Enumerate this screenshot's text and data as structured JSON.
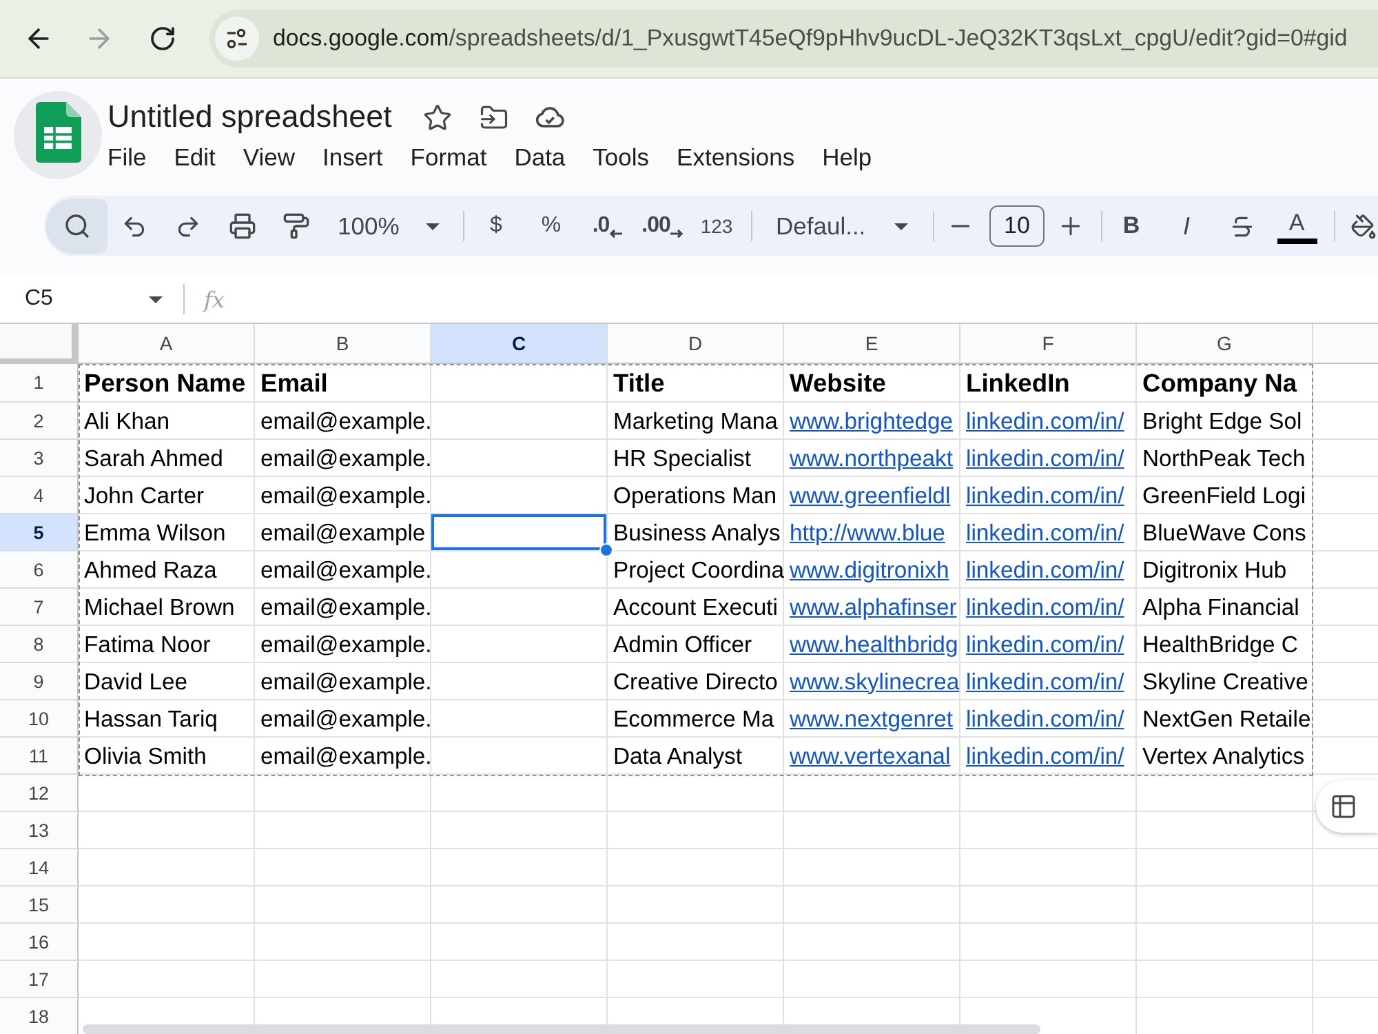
{
  "browser": {
    "back": {
      "disabled": false
    },
    "forward": {
      "disabled": true
    },
    "url_host": "docs.google.com",
    "url_path": "/spreadsheets/d/1_PxusgwtT45eQf9pHhv9ucDL-JeQ32KT3qsLxt_cpgU/edit?gid=0#gid"
  },
  "document": {
    "title": "Untitled spreadsheet"
  },
  "menu": [
    "File",
    "Edit",
    "View",
    "Insert",
    "Format",
    "Data",
    "Tools",
    "Extensions",
    "Help"
  ],
  "toolbar": {
    "zoom": "100%",
    "currency": "$",
    "percent": "%",
    "decrease_decimal": ".0",
    "increase_decimal": ".00",
    "number_format": "123",
    "font": "Defaul...",
    "font_size": "10",
    "bold": "B",
    "italic": "I",
    "text_color": "A"
  },
  "formula_bar": {
    "name_box": "C5",
    "function_label": "fx"
  },
  "sheet": {
    "copy_outline": true,
    "columns": [
      {
        "label": "A",
        "selected": false
      },
      {
        "label": "B",
        "selected": false
      },
      {
        "label": "C",
        "selected": true
      },
      {
        "label": "D",
        "selected": false
      },
      {
        "label": "E",
        "selected": false
      },
      {
        "label": "F",
        "selected": false
      },
      {
        "label": "G",
        "selected": false
      }
    ],
    "rows": [
      {
        "number": "1",
        "kind": "header",
        "selected": false,
        "cells": [
          {
            "kind": "text",
            "text": "Person Name"
          },
          {
            "kind": "text",
            "text": "Email"
          },
          {
            "kind": "empty"
          },
          {
            "kind": "text",
            "text": "Title"
          },
          {
            "kind": "text",
            "text": "Website"
          },
          {
            "kind": "text",
            "text": "LinkedIn"
          },
          {
            "kind": "text",
            "text": "Company Na"
          }
        ]
      },
      {
        "number": "2",
        "kind": "data",
        "selected": false,
        "cells": [
          {
            "kind": "text",
            "text": "Ali Khan"
          },
          {
            "kind": "text",
            "text": "email@example."
          },
          {
            "kind": "empty"
          },
          {
            "kind": "text",
            "text": "Marketing Mana"
          },
          {
            "kind": "link",
            "text": "www.brightedge"
          },
          {
            "kind": "link",
            "text": "linkedin.com/in/"
          },
          {
            "kind": "text",
            "text": "Bright Edge Sol"
          }
        ]
      },
      {
        "number": "3",
        "kind": "data",
        "selected": false,
        "cells": [
          {
            "kind": "text",
            "text": "Sarah Ahmed"
          },
          {
            "kind": "text",
            "text": "email@example."
          },
          {
            "kind": "empty"
          },
          {
            "kind": "text",
            "text": "HR Specialist"
          },
          {
            "kind": "link",
            "text": "www.northpeakt"
          },
          {
            "kind": "link",
            "text": "linkedin.com/in/"
          },
          {
            "kind": "text",
            "text": "NorthPeak Tech"
          }
        ]
      },
      {
        "number": "4",
        "kind": "data",
        "selected": false,
        "cells": [
          {
            "kind": "text",
            "text": "John Carter"
          },
          {
            "kind": "text",
            "text": "email@example."
          },
          {
            "kind": "empty"
          },
          {
            "kind": "text",
            "text": "Operations Man"
          },
          {
            "kind": "link",
            "text": "www.greenfieldl"
          },
          {
            "kind": "link",
            "text": "linkedin.com/in/"
          },
          {
            "kind": "text",
            "text": "GreenField Logi"
          }
        ]
      },
      {
        "number": "5",
        "kind": "data",
        "selected": true,
        "cells": [
          {
            "kind": "text",
            "text": "Emma Wilson"
          },
          {
            "kind": "text",
            "text": "email@example"
          },
          {
            "kind": "empty"
          },
          {
            "kind": "text",
            "text": "Business Analys"
          },
          {
            "kind": "link",
            "text": "http://www.blue"
          },
          {
            "kind": "link",
            "text": "linkedin.com/in/"
          },
          {
            "kind": "text",
            "text": "BlueWave Cons"
          }
        ]
      },
      {
        "number": "6",
        "kind": "data",
        "selected": false,
        "cells": [
          {
            "kind": "text",
            "text": "Ahmed Raza"
          },
          {
            "kind": "text",
            "text": "email@example."
          },
          {
            "kind": "empty"
          },
          {
            "kind": "text",
            "text": "Project Coordina"
          },
          {
            "kind": "link",
            "text": "www.digitronixh"
          },
          {
            "kind": "link",
            "text": "linkedin.com/in/"
          },
          {
            "kind": "text",
            "text": "Digitronix Hub"
          }
        ]
      },
      {
        "number": "7",
        "kind": "data",
        "selected": false,
        "cells": [
          {
            "kind": "text",
            "text": "Michael Brown"
          },
          {
            "kind": "text",
            "text": "email@example."
          },
          {
            "kind": "empty"
          },
          {
            "kind": "text",
            "text": "Account Executi"
          },
          {
            "kind": "link",
            "text": "www.alphafinser"
          },
          {
            "kind": "link",
            "text": "linkedin.com/in/"
          },
          {
            "kind": "text",
            "text": "Alpha Financial"
          }
        ]
      },
      {
        "number": "8",
        "kind": "data",
        "selected": false,
        "cells": [
          {
            "kind": "text",
            "text": "Fatima Noor"
          },
          {
            "kind": "text",
            "text": "email@example."
          },
          {
            "kind": "empty"
          },
          {
            "kind": "text",
            "text": "Admin Officer"
          },
          {
            "kind": "link",
            "text": "www.healthbridg"
          },
          {
            "kind": "link",
            "text": "linkedin.com/in/"
          },
          {
            "kind": "text",
            "text": "HealthBridge C"
          }
        ]
      },
      {
        "number": "9",
        "kind": "data",
        "selected": false,
        "cells": [
          {
            "kind": "text",
            "text": "David Lee"
          },
          {
            "kind": "text",
            "text": "email@example."
          },
          {
            "kind": "empty"
          },
          {
            "kind": "text",
            "text": "Creative Directo"
          },
          {
            "kind": "link",
            "text": "www.skylinecrea"
          },
          {
            "kind": "link",
            "text": "linkedin.com/in/"
          },
          {
            "kind": "text",
            "text": "Skyline Creative"
          }
        ]
      },
      {
        "number": "10",
        "kind": "data",
        "selected": false,
        "cells": [
          {
            "kind": "text",
            "text": "Hassan Tariq"
          },
          {
            "kind": "text",
            "text": "email@example."
          },
          {
            "kind": "empty"
          },
          {
            "kind": "text",
            "text": "Ecommerce Ma"
          },
          {
            "kind": "link",
            "text": "www.nextgenret"
          },
          {
            "kind": "link",
            "text": "linkedin.com/in/"
          },
          {
            "kind": "text",
            "text": "NextGen Retaile"
          }
        ]
      },
      {
        "number": "11",
        "kind": "data",
        "selected": false,
        "cells": [
          {
            "kind": "text",
            "text": "Olivia Smith"
          },
          {
            "kind": "text",
            "text": "email@example."
          },
          {
            "kind": "empty"
          },
          {
            "kind": "text",
            "text": "Data Analyst"
          },
          {
            "kind": "link",
            "text": "www.vertexanal"
          },
          {
            "kind": "link",
            "text": "linkedin.com/in/"
          },
          {
            "kind": "text",
            "text": "Vertex Analytics"
          }
        ]
      },
      {
        "number": "12",
        "kind": "data",
        "selected": false
      },
      {
        "number": "13",
        "kind": "data",
        "selected": false
      },
      {
        "number": "14",
        "kind": "data",
        "selected": false
      },
      {
        "number": "15",
        "kind": "data",
        "selected": false
      },
      {
        "number": "16",
        "kind": "data",
        "selected": false
      },
      {
        "number": "17",
        "kind": "data",
        "selected": false
      },
      {
        "number": "18",
        "kind": "data",
        "selected": false
      }
    ]
  }
}
